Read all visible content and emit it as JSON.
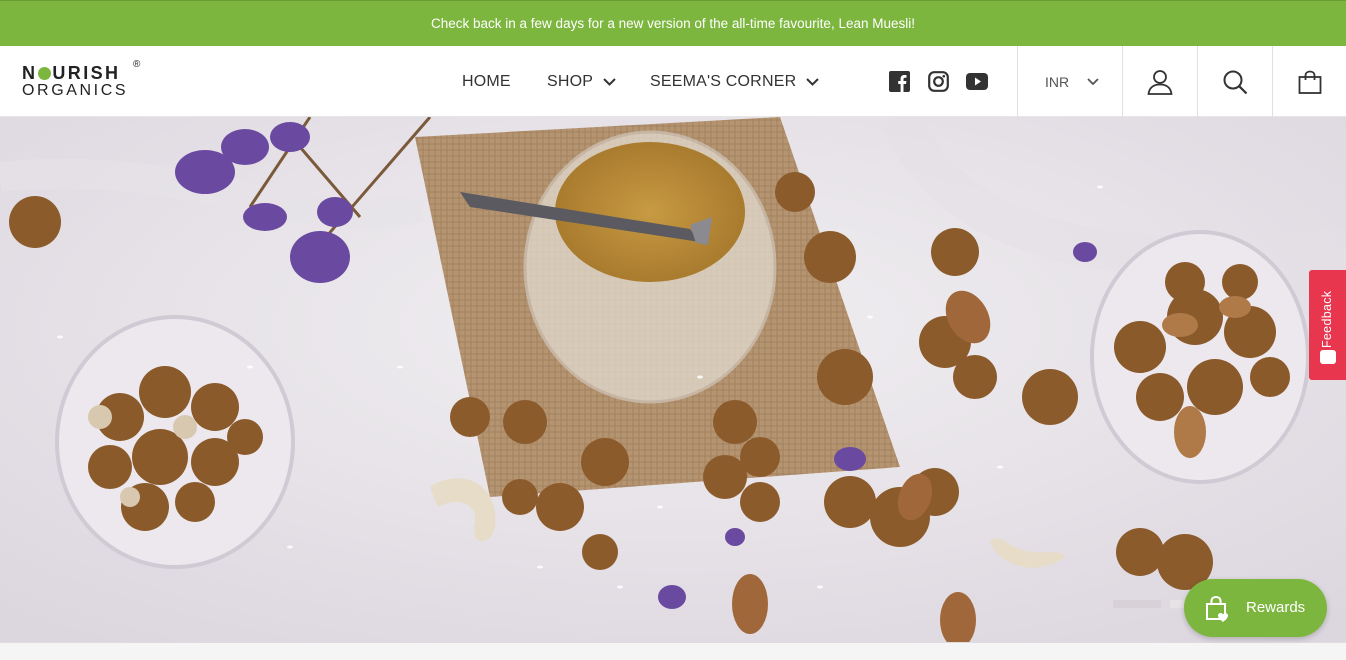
{
  "announcement": "Check back in a few days for a new version of the all-time favourite, Lean Muesli!",
  "logo": {
    "line1_a": "N",
    "line1_b": "URISH",
    "line2": "ORGANICS",
    "reg": "®"
  },
  "nav": [
    {
      "label": "HOME"
    },
    {
      "label": "SHOP"
    },
    {
      "label": "SEEMA'S CORNER"
    }
  ],
  "social_icons": [
    "facebook-icon",
    "instagram-icon",
    "youtube-icon"
  ],
  "currency": "INR",
  "header_icons": [
    "account-icon",
    "search-icon",
    "cart-icon"
  ],
  "feedback_label": "Feedback",
  "rewards_label": "Rewards",
  "colors": {
    "brand_green": "#7db63f",
    "feedback_red": "#e8364f",
    "text_dark": "#333333"
  }
}
